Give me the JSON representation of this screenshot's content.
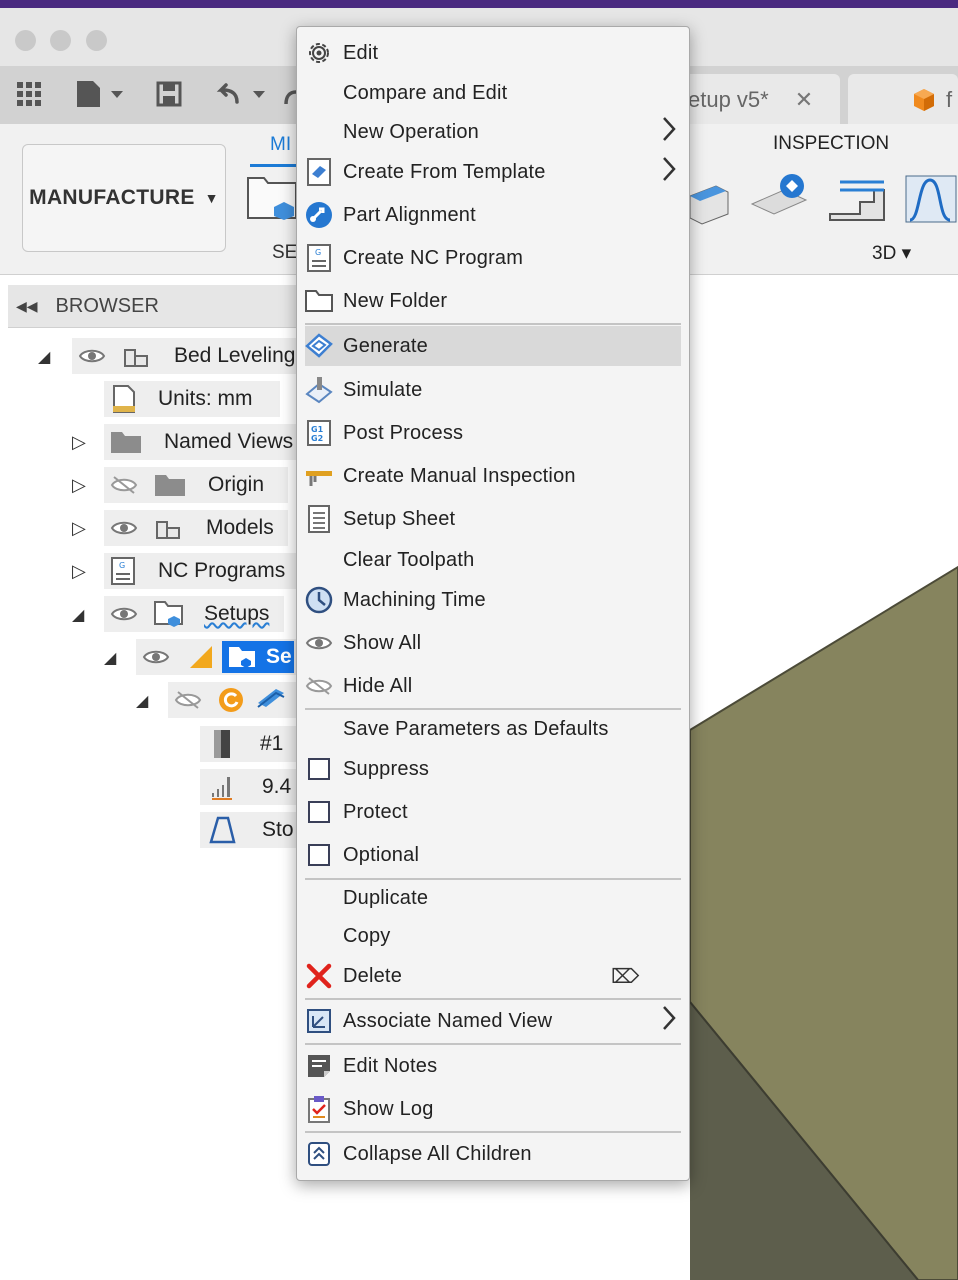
{
  "toolbar": {
    "tab_active": "etup v5*",
    "tab_next": "f",
    "close_glyph": "✕"
  },
  "ribbon": {
    "workspace": "MANUFACTURE",
    "milling_tab": "MI",
    "setup_label": "SE",
    "inspection_label": "INSPECTION",
    "threed_label": "3D ▾"
  },
  "browser": {
    "title": "BROWSER",
    "rows": [
      {
        "label": "Bed Leveling"
      },
      {
        "label": "Units: mm"
      },
      {
        "label": "Named Views"
      },
      {
        "label": "Origin"
      },
      {
        "label": "Models"
      },
      {
        "label": "NC Programs"
      },
      {
        "label": "Setups"
      },
      {
        "label": "Se"
      },
      {
        "label": ""
      },
      {
        "label": "#1"
      },
      {
        "label": "9.4"
      },
      {
        "label": "Sto"
      }
    ]
  },
  "menu": {
    "items": [
      {
        "label": "Edit",
        "icon": "gear-icon"
      },
      {
        "label": "Compare and Edit"
      },
      {
        "label": "New Operation",
        "submenu": true
      },
      {
        "label": "Create From Template",
        "icon": "template-icon",
        "submenu": true
      },
      {
        "label": "Part Alignment",
        "icon": "part-alignment-icon"
      },
      {
        "label": "Create NC Program",
        "icon": "nc-program-icon"
      },
      {
        "label": "New Folder",
        "icon": "folder-icon"
      },
      {
        "label": "Generate",
        "icon": "generate-icon",
        "highlighted": true
      },
      {
        "label": "Simulate",
        "icon": "simulate-icon"
      },
      {
        "label": "Post Process",
        "icon": "post-process-icon"
      },
      {
        "label": "Create Manual Inspection",
        "icon": "caliper-icon"
      },
      {
        "label": "Setup Sheet",
        "icon": "setup-sheet-icon"
      },
      {
        "label": "Clear Toolpath"
      },
      {
        "label": "Machining Time",
        "icon": "clock-icon"
      },
      {
        "label": "Show All",
        "icon": "eye-icon"
      },
      {
        "label": "Hide All",
        "icon": "eye-hidden-icon"
      },
      {
        "label": "Save Parameters as Defaults"
      },
      {
        "label": "Suppress",
        "icon": "checkbox-icon"
      },
      {
        "label": "Protect",
        "icon": "checkbox-icon"
      },
      {
        "label": "Optional",
        "icon": "checkbox-icon"
      },
      {
        "label": "Duplicate"
      },
      {
        "label": "Copy"
      },
      {
        "label": "Delete",
        "icon": "delete-x-icon",
        "shortcut": "⌦"
      },
      {
        "label": "Associate Named View",
        "icon": "named-view-icon",
        "submenu": true
      },
      {
        "label": "Edit Notes",
        "icon": "notes-icon"
      },
      {
        "label": "Show Log",
        "icon": "clipboard-log-icon"
      },
      {
        "label": "Collapse All Children",
        "icon": "collapse-icon"
      }
    ]
  },
  "colors": {
    "selection_blue": "#1473e6",
    "delete_red": "#e0231c",
    "stock_olive": "#86845e",
    "stock_dark": "#5d5e4c",
    "generate_blue": "#3d7fd1"
  }
}
